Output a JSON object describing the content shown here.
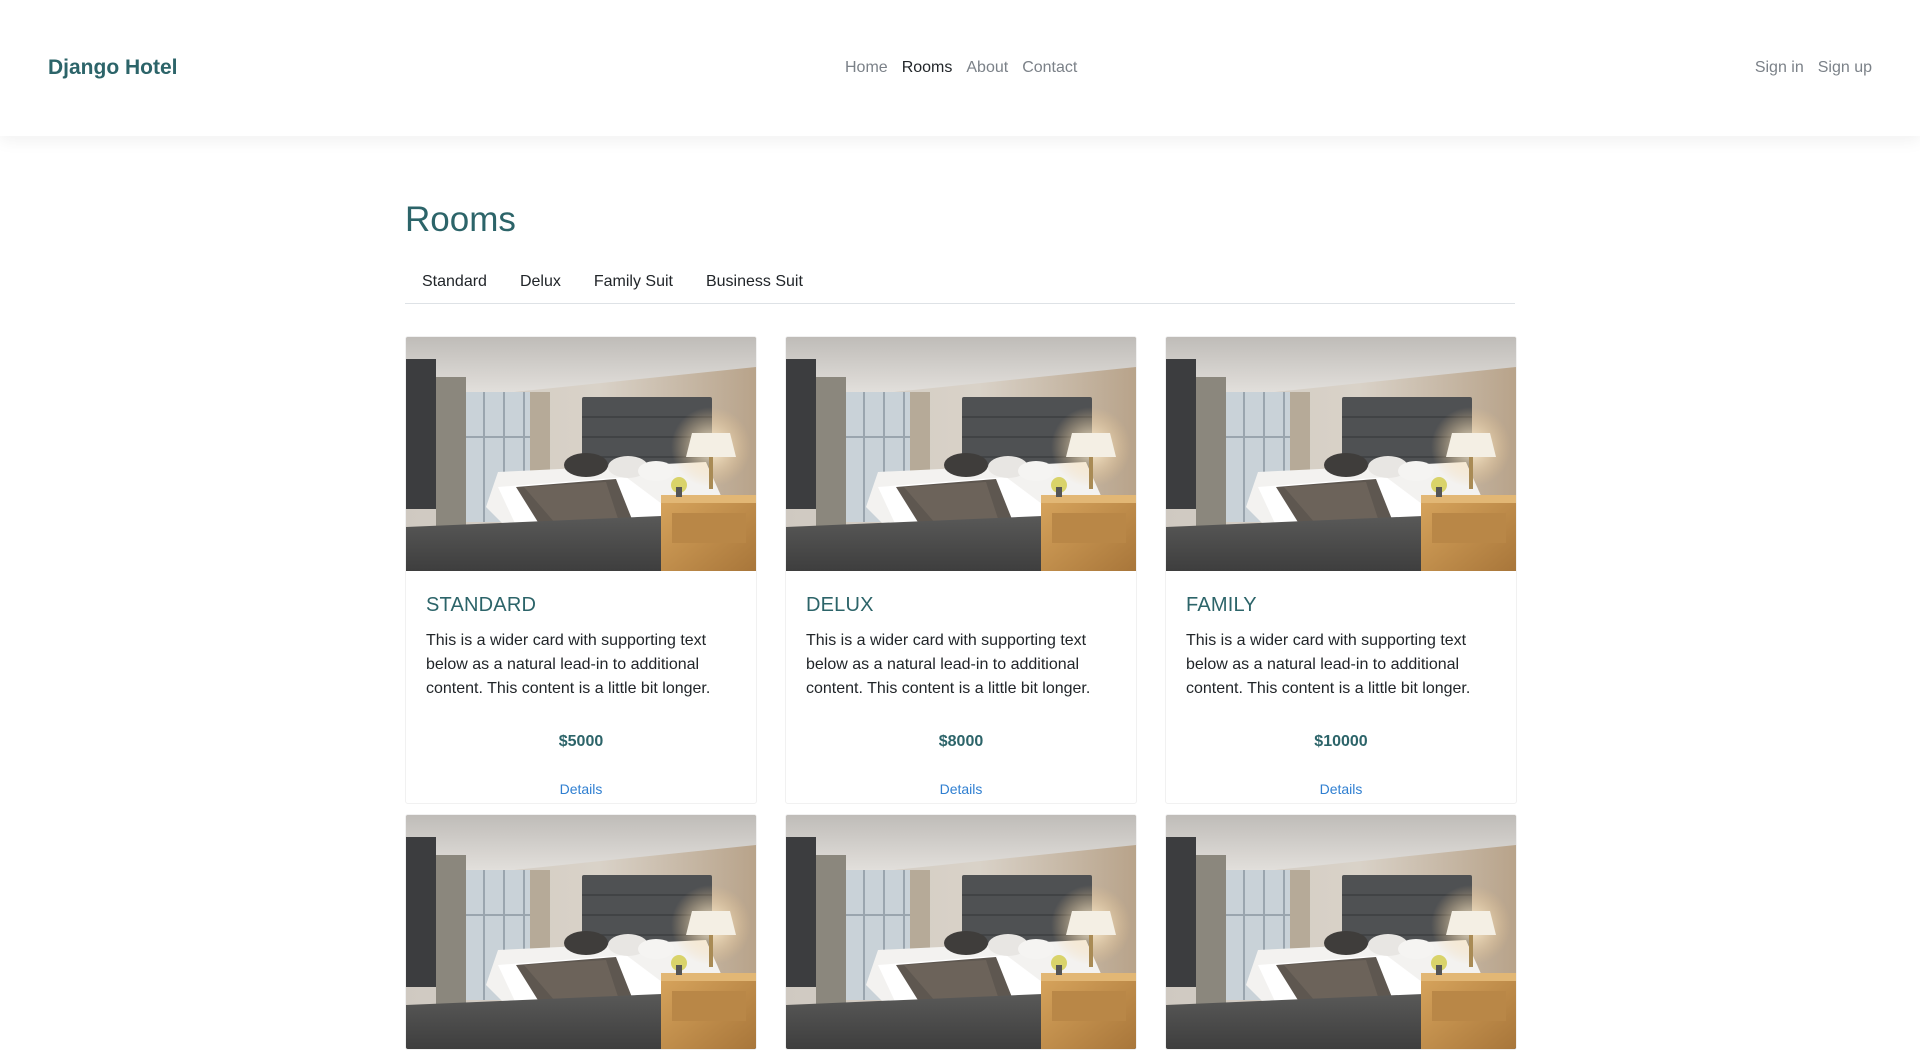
{
  "navbar": {
    "brand": "Django Hotel",
    "links": [
      "Home",
      "Rooms",
      "About",
      "Contact"
    ],
    "active": "Rooms",
    "auth": [
      "Sign in",
      "Sign up"
    ]
  },
  "page": {
    "title": "Rooms",
    "tabs": [
      "Standard",
      "Delux",
      "Family Suit",
      "Business Suit"
    ]
  },
  "rooms": [
    {
      "title": "STANDARD",
      "text": "This is a wider card with supporting text below as a natural lead-in to additional content. This content is a little bit longer.",
      "price": "$5000",
      "link": "Details"
    },
    {
      "title": "DELUX",
      "text": "This is a wider card with supporting text below as a natural lead-in to additional content. This content is a little bit longer.",
      "price": "$8000",
      "link": "Details"
    },
    {
      "title": "FAMILY",
      "text": "This is a wider card with supporting text below as a natural lead-in to additional content. This content is a little bit longer.",
      "price": "$10000",
      "link": "Details"
    }
  ],
  "colors": {
    "brand": "#2c6469",
    "link": "#2f7fd1",
    "nav_muted": "#7b8188"
  }
}
